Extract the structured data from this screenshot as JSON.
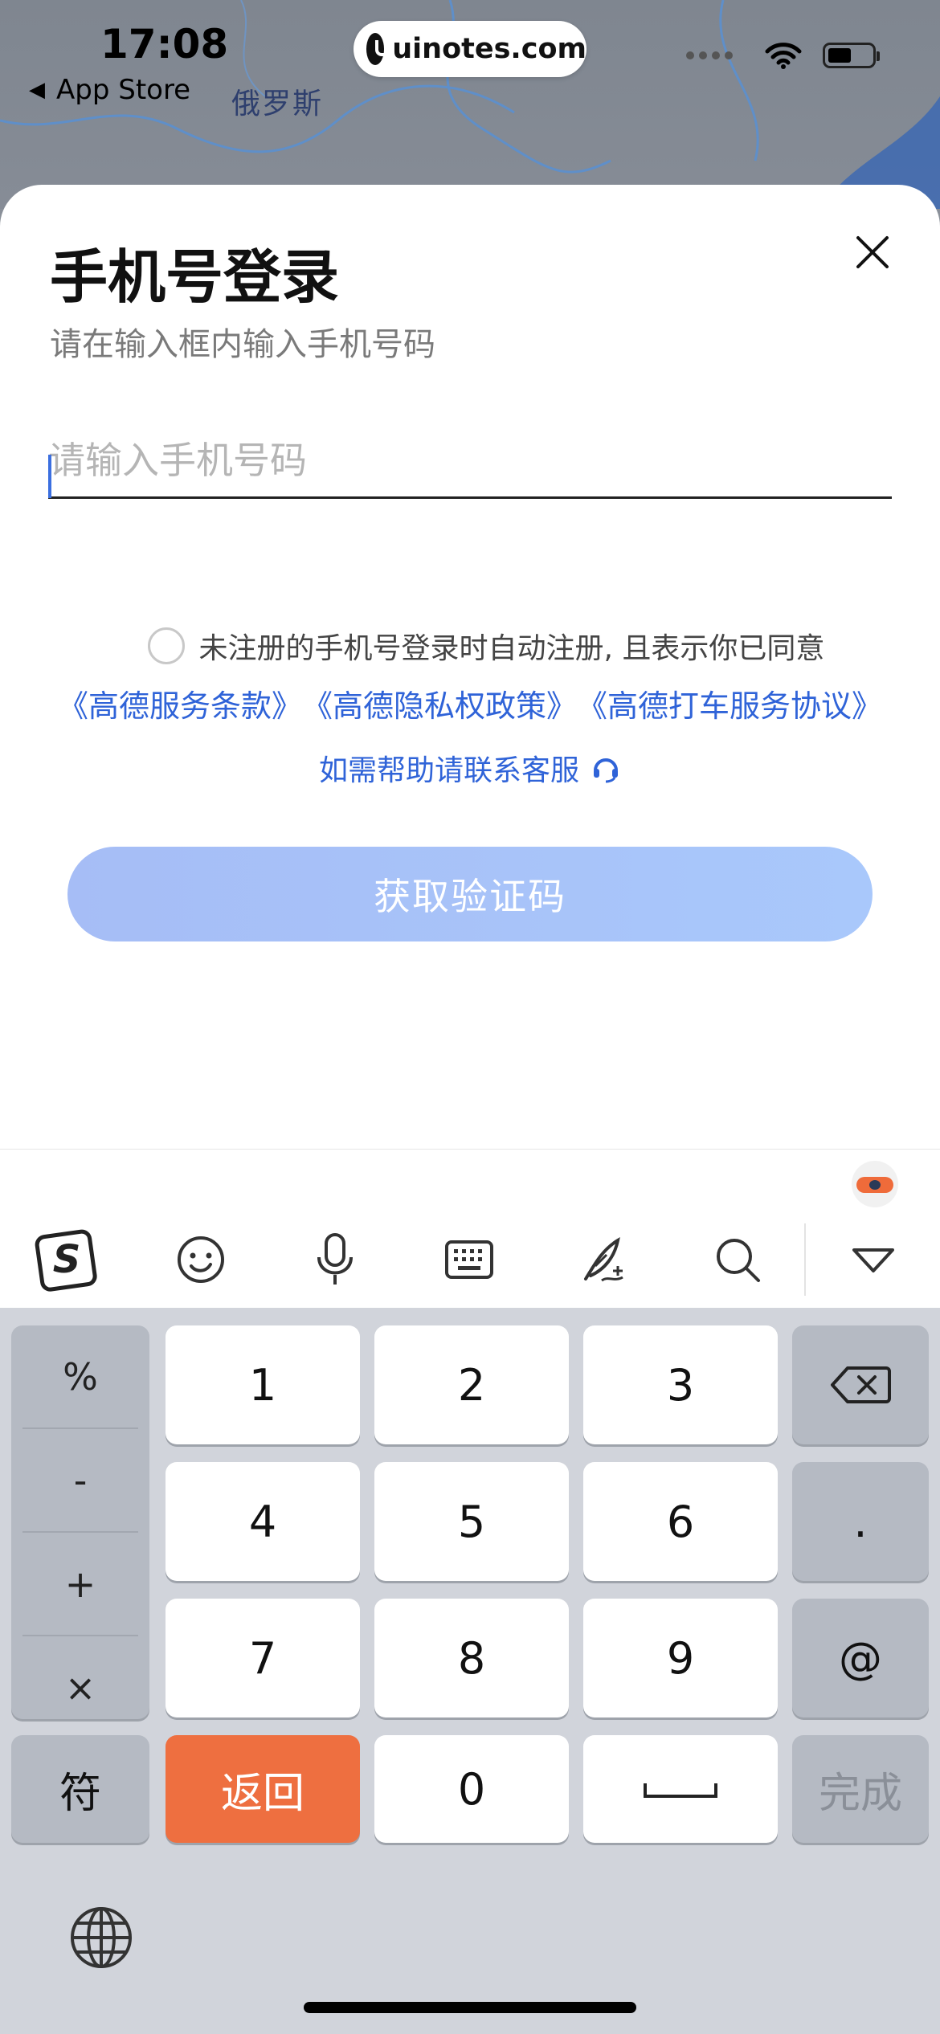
{
  "status_bar": {
    "time": "17:08",
    "back_label": "App Store",
    "url": "uinotes.com"
  },
  "map": {
    "label": "俄罗斯"
  },
  "login": {
    "title": "手机号登录",
    "subtitle": "请在输入框内输入手机号码",
    "phone_placeholder": "请输入手机号码",
    "agree_text": "未注册的手机号登录时自动注册, 且表示你已同意",
    "links": [
      "《高德服务条款》",
      "《高德隐私权政策》",
      "《高德打车服务协议》"
    ],
    "help_text": "如需帮助请联系客服",
    "get_code_label": "获取验证码"
  },
  "keyboard": {
    "toolbar_icons": [
      "sogou-logo-icon",
      "emoji-icon",
      "microphone-icon",
      "keyboard-icon",
      "handwriting-icon",
      "search-icon",
      "collapse-icon"
    ],
    "symbols": [
      "%",
      "-",
      "+",
      "×"
    ],
    "digits": [
      "1",
      "2",
      "3",
      "4",
      "5",
      "6",
      "7",
      "8",
      "9",
      "0"
    ],
    "dot": ".",
    "at": "@",
    "symbol_key": "符",
    "back_key": "返回",
    "done_key": "完成",
    "accent_color": "#ee6f40"
  },
  "colors": {
    "link": "#2f63d8",
    "button": "#a9c3f8"
  }
}
